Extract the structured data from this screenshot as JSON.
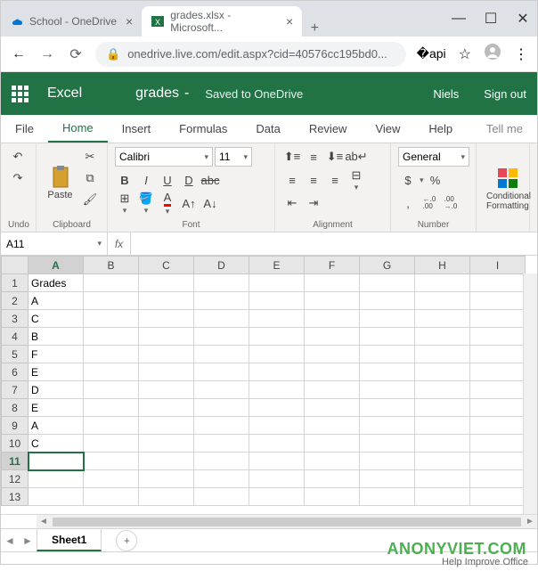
{
  "browser": {
    "tab1_title": "School - OneDrive",
    "tab2_title": "grades.xlsx - Microsoft...",
    "url": "onedrive.live.com/edit.aspx?cid=40576cc195bd0..."
  },
  "header": {
    "app_name": "Excel",
    "doc_name": "grades",
    "dash": "-",
    "save_status": "Saved to OneDrive",
    "user": "Niels",
    "sign_out": "Sign out"
  },
  "ribbon_tabs": {
    "file": "File",
    "home": "Home",
    "insert": "Insert",
    "formulas": "Formulas",
    "data": "Data",
    "review": "Review",
    "view": "View",
    "help": "Help",
    "tell_me": "Tell me"
  },
  "ribbon": {
    "undo_label": "Undo",
    "paste_label": "Paste",
    "clipboard_label": "Clipboard",
    "font_name": "Calibri",
    "font_size": "11",
    "font_label": "Font",
    "alignment_label": "Alignment",
    "number_format": "General",
    "number_label": "Number",
    "cond_fmt": "Conditional Formatting",
    "b": "B",
    "i": "I",
    "u": "U",
    "d": "D",
    "abc": "abc",
    "dollar": "$",
    "percent": "%",
    "comma": ",",
    "inc_dec": "←.0\n.00",
    "dec_dec": ".00\n→.0"
  },
  "formula_bar": {
    "name_box": "A11",
    "fx": "fx",
    "formula": ""
  },
  "grid": {
    "columns": [
      "A",
      "B",
      "C",
      "D",
      "E",
      "F",
      "G",
      "H",
      "I"
    ],
    "rows": [
      "1",
      "2",
      "3",
      "4",
      "5",
      "6",
      "7",
      "8",
      "9",
      "10",
      "11",
      "12",
      "13"
    ],
    "selected_cell": "A11",
    "data": {
      "A1": "Grades",
      "A2": "A",
      "A3": "C",
      "A4": "B",
      "A5": "F",
      "A6": "E",
      "A7": "D",
      "A8": "E",
      "A9": "A",
      "A10": "C"
    }
  },
  "sheet_bar": {
    "sheet1": "Sheet1"
  },
  "status_bar": {
    "help": "Help Improve Office"
  },
  "watermark": "ANONYVIET.COM",
  "chart_data": {
    "type": "table",
    "title": "Grades",
    "columns": [
      "Grades"
    ],
    "rows": [
      [
        "A"
      ],
      [
        "C"
      ],
      [
        "B"
      ],
      [
        "F"
      ],
      [
        "E"
      ],
      [
        "D"
      ],
      [
        "E"
      ],
      [
        "A"
      ],
      [
        "C"
      ]
    ]
  }
}
